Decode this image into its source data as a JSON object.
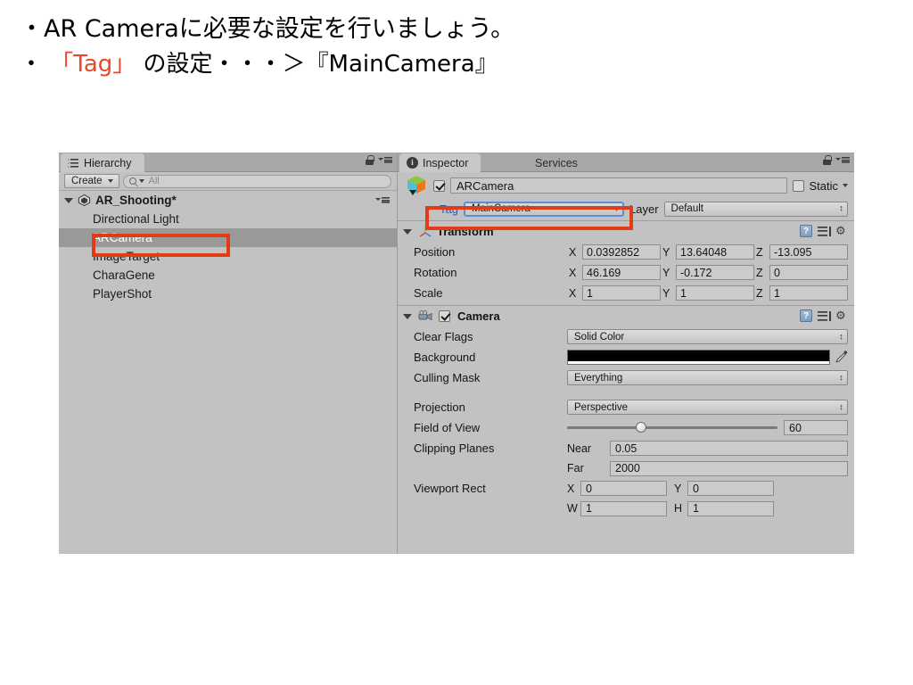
{
  "slide": {
    "line1": "・AR Cameraに必要な設定を行いましょう。",
    "line2_prefix": "・ ",
    "line2_accent": "「Tag」",
    "line2_suffix": " の設定・・・＞『MainCamera』",
    "accent_color": "#e8492b"
  },
  "hierarchy": {
    "tab_label": "Hierarchy",
    "create_label": "Create",
    "search_placeholder": "All",
    "root": {
      "label": "AR_Shooting*"
    },
    "items": [
      {
        "label": "Directional Light",
        "selected": false
      },
      {
        "label": "ARCamera",
        "selected": true
      },
      {
        "label": "ImageTarget",
        "selected": false
      },
      {
        "label": "CharaGene",
        "selected": false
      },
      {
        "label": "PlayerShot",
        "selected": false
      }
    ]
  },
  "inspector": {
    "tabs": [
      {
        "label": "Inspector",
        "active": true
      },
      {
        "label": "Services",
        "active": false
      }
    ],
    "object_name": "ARCamera",
    "object_enabled": true,
    "static_label": "Static",
    "static_checked": false,
    "tag_label": "Tag",
    "tag_value": "MainCamera",
    "layer_label": "Layer",
    "layer_value": "Default",
    "transform": {
      "title": "Transform",
      "rows": [
        {
          "label": "Position",
          "x": "0.0392852",
          "y": "13.64048",
          "z": "-13.095"
        },
        {
          "label": "Rotation",
          "x": "46.169",
          "y": "-0.172",
          "z": "0"
        },
        {
          "label": "Scale",
          "x": "1",
          "y": "1",
          "z": "1"
        }
      ],
      "axis_labels": {
        "x": "X",
        "y": "Y",
        "z": "Z"
      }
    },
    "camera": {
      "title": "Camera",
      "enabled": true,
      "clear_flags_label": "Clear Flags",
      "clear_flags_value": "Solid Color",
      "background_label": "Background",
      "background_color": "#000000",
      "culling_mask_label": "Culling Mask",
      "culling_mask_value": "Everything",
      "projection_label": "Projection",
      "projection_value": "Perspective",
      "fov_label": "Field of View",
      "fov_value": "60",
      "fov_slider_percent": 35,
      "clipping_label": "Clipping Planes",
      "near_label": "Near",
      "near_value": "0.05",
      "far_label": "Far",
      "far_value": "2000",
      "viewport_label": "Viewport Rect",
      "viewport_x_label": "X",
      "viewport_x": "0",
      "viewport_y_label": "Y",
      "viewport_y": "0",
      "viewport_w_label": "W",
      "viewport_w": "1",
      "viewport_h_label": "H",
      "viewport_h": "1"
    }
  },
  "annotations": {
    "highlight_color": "#e23b16"
  }
}
